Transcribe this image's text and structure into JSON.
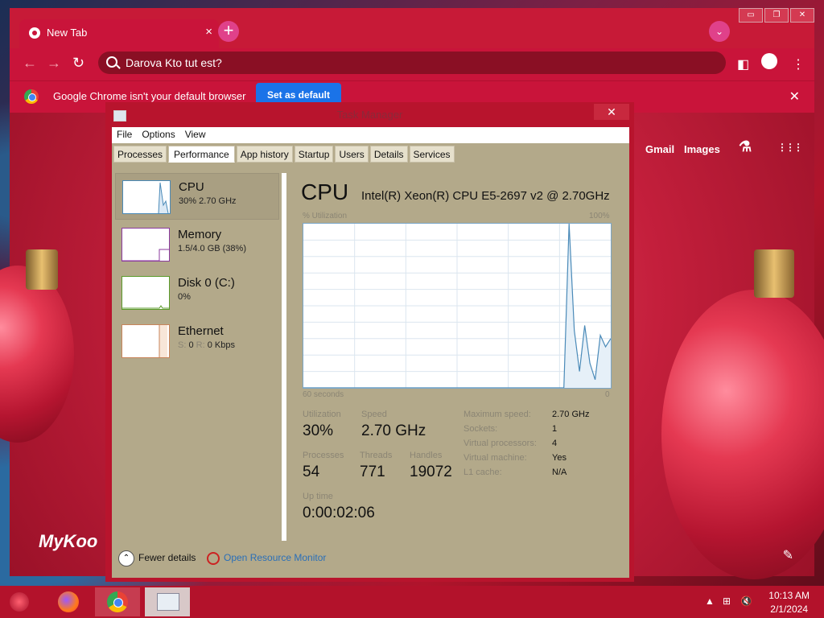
{
  "browser": {
    "tab_title": "New Tab",
    "tab_close": "×",
    "new_tab": "+",
    "profile_menu": "⌄",
    "window_buttons": [
      "▭",
      "❐",
      "✕"
    ],
    "back": "←",
    "forward": "→",
    "reload": "↻",
    "omnibox_text": "Darova Kto tut est?",
    "infobar_message": "Google Chrome isn't your default browser",
    "set_default_label": "Set as default",
    "infobar_close": "✕",
    "gmail": "Gmail",
    "images": "Images",
    "labs_icon": "⚗",
    "apps_icon": "⋮⋮⋮",
    "brand_text": "MyKoo",
    "edit_icon": "✎",
    "accent": "#c9143a",
    "button_blue": "#1a73e8"
  },
  "task_manager": {
    "title": "Task Manager",
    "close": "✕",
    "menu": [
      "File",
      "Options",
      "View"
    ],
    "tabs": [
      "Processes",
      "Performance",
      "App history",
      "Startup",
      "Users",
      "Details",
      "Services"
    ],
    "active_tab": "Performance",
    "sidebar": [
      {
        "name": "CPU",
        "detail": "30%  2.70 GHz",
        "selected": true
      },
      {
        "name": "Memory",
        "detail": "1.5/4.0 GB (38%)",
        "selected": false
      },
      {
        "name": "Disk 0 (C:)",
        "detail": "0%",
        "selected": false
      },
      {
        "name": "Ethernet",
        "detail_s": "S:",
        "detail_s_val": "0",
        "detail_r": "R:",
        "detail_r_val": "0 Kbps",
        "selected": false
      }
    ],
    "panel": {
      "heading": "CPU",
      "cpu_name": "Intel(R) Xeon(R) CPU E5-2697 v2 @ 2.70GHz",
      "y_label": "% Utilization",
      "y_max": "100%",
      "x_left": "60 seconds",
      "x_right": "0",
      "stats": {
        "utilization_label": "Utilization",
        "utilization": "30%",
        "speed_label": "Speed",
        "speed": "2.70 GHz",
        "processes_label": "Processes",
        "processes": "54",
        "threads_label": "Threads",
        "threads": "771",
        "handles_label": "Handles",
        "handles": "19072",
        "uptime_label": "Up time",
        "uptime": "0:00:02:06"
      },
      "details": [
        {
          "k": "Maximum speed:",
          "v": "2.70 GHz"
        },
        {
          "k": "Sockets:",
          "v": "1"
        },
        {
          "k": "Virtual processors:",
          "v": "4"
        },
        {
          "k": "Virtual machine:",
          "v": "Yes"
        },
        {
          "k": "L1 cache:",
          "v": "N/A"
        }
      ]
    },
    "fewer_details": "Fewer details",
    "open_resource_monitor": "Open Resource Monitor",
    "graph_color": "#4a8ab8"
  },
  "chart_data": {
    "type": "line",
    "series": [
      {
        "values": [
          0,
          0,
          0,
          0,
          0,
          0,
          0,
          0,
          0,
          0,
          0,
          0,
          0,
          0,
          0,
          0,
          0,
          0,
          0,
          0,
          0,
          0,
          0,
          0,
          0,
          0,
          0,
          0,
          0,
          0,
          0,
          0,
          0,
          0,
          0,
          0,
          0,
          0,
          0,
          0,
          0,
          0,
          0,
          0,
          0,
          0,
          0,
          0,
          0,
          0,
          0,
          100,
          35,
          10,
          38,
          15,
          5,
          32,
          25,
          30
        ]
      }
    ],
    "xlim": [
      60,
      0
    ],
    "ylim": [
      0,
      100
    ],
    "grid": true
  },
  "taskbar": {
    "time": "10:13 AM",
    "date": "2/1/2024",
    "tray_up": "▲",
    "network_icon": "⊞",
    "volume_icon": "🔇"
  }
}
